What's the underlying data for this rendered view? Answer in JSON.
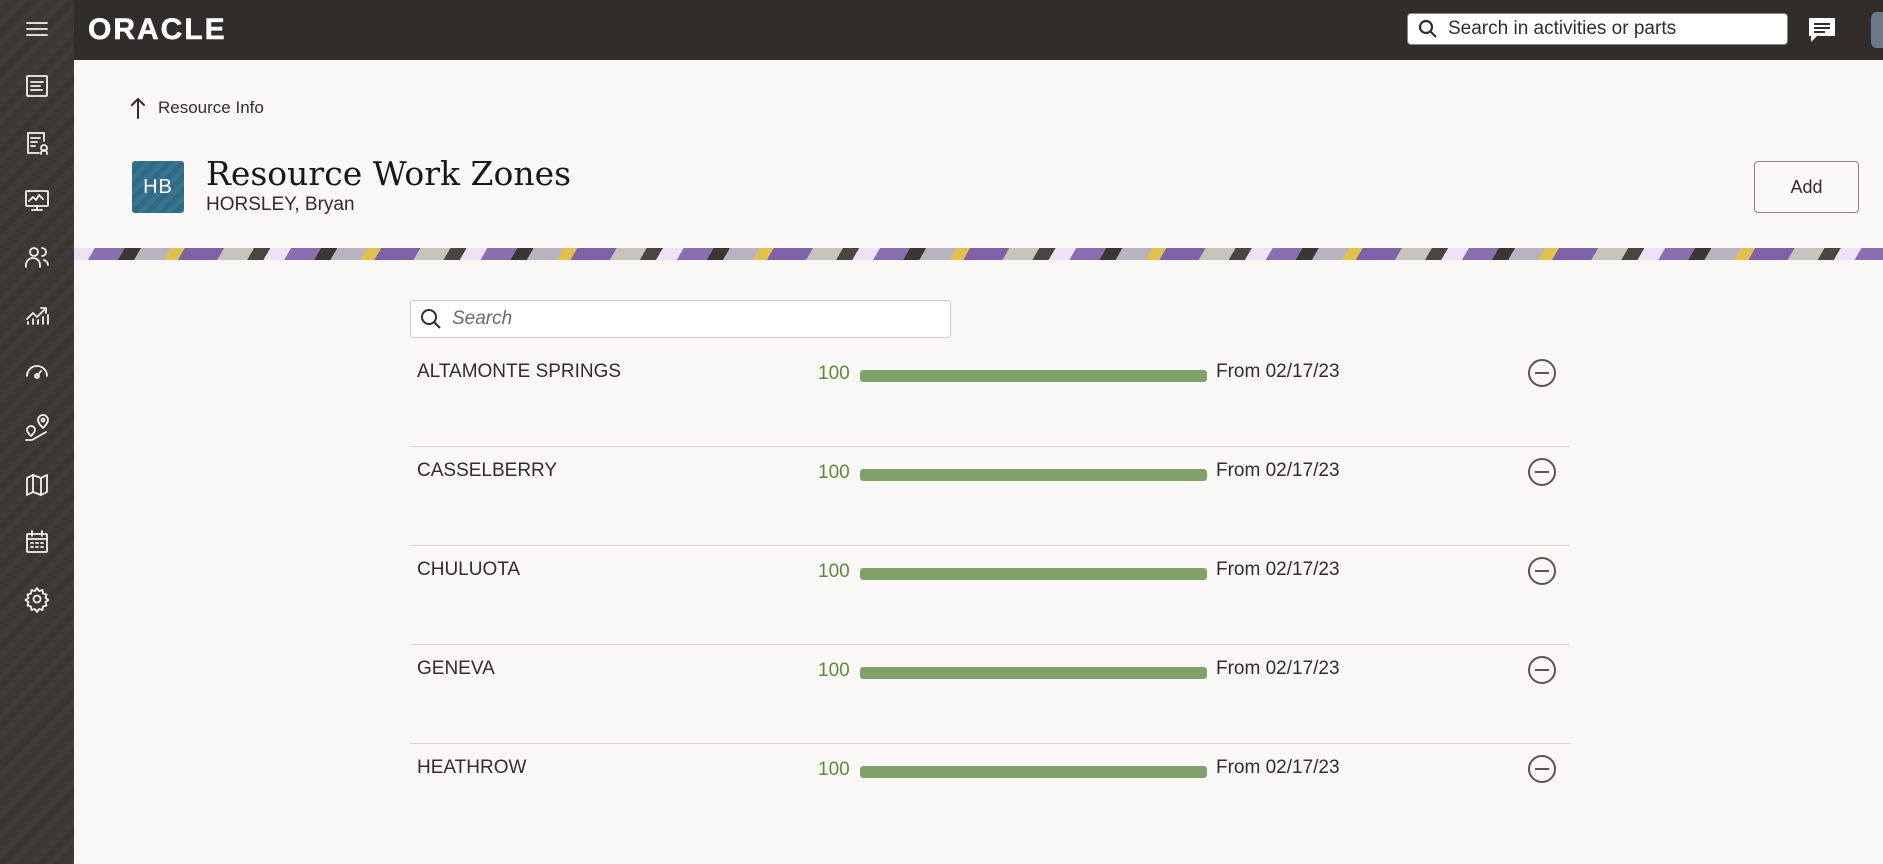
{
  "app": {
    "logo_text": "ORACLE",
    "search_placeholder": "Search in activities or parts"
  },
  "nav": {
    "items": [
      {
        "icon": "menu-icon"
      },
      {
        "icon": "activity-list-icon"
      },
      {
        "icon": "dispatch-console-icon"
      },
      {
        "icon": "monitor-dashboard-icon"
      },
      {
        "icon": "resources-icon"
      },
      {
        "icon": "analytics-chart-icon"
      },
      {
        "icon": "gauge-icon"
      },
      {
        "icon": "route-map-icon"
      },
      {
        "icon": "map-icon"
      },
      {
        "icon": "calendar-icon"
      },
      {
        "icon": "gear-icon"
      }
    ]
  },
  "header": {
    "breadcrumb_label": "Resource Info",
    "avatar_initials": "HB",
    "title": "Resource Work Zones",
    "subtitle": "HORSLEY, Bryan",
    "add_label": "Add"
  },
  "search": {
    "placeholder": "Search"
  },
  "zones": [
    {
      "name": "ALTAMONTE SPRINGS",
      "ratio": "100",
      "ratio_fraction": 1.0,
      "date": "From 02/17/23"
    },
    {
      "name": "CASSELBERRY",
      "ratio": "100",
      "ratio_fraction": 1.0,
      "date": "From 02/17/23"
    },
    {
      "name": "CHULUOTA",
      "ratio": "100",
      "ratio_fraction": 1.0,
      "date": "From 02/17/23"
    },
    {
      "name": "GENEVA",
      "ratio": "100",
      "ratio_fraction": 1.0,
      "date": "From 02/17/23"
    },
    {
      "name": "HEATHROW",
      "ratio": "100",
      "ratio_fraction": 1.0,
      "date": "From 02/17/23"
    }
  ],
  "colors": {
    "ratio_text": "#5c8a3a",
    "bar_fill": "#7fa26b",
    "avatar_bg": "#2e6a86",
    "topbar_bg": "#312d2a"
  }
}
